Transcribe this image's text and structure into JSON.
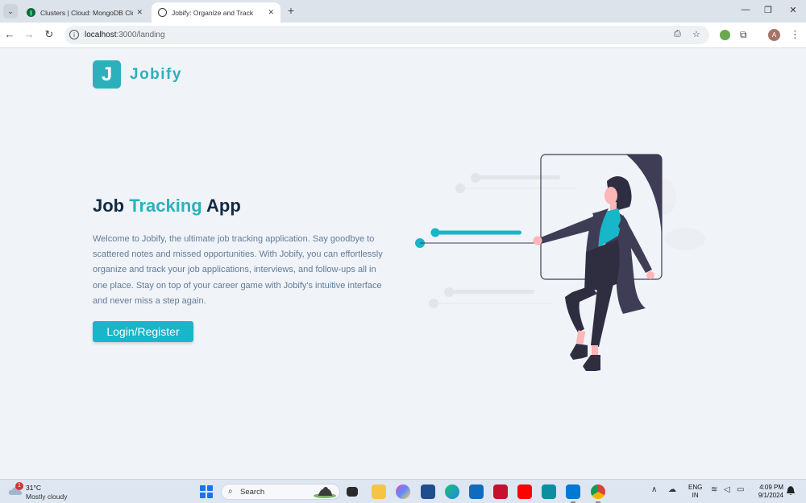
{
  "browser": {
    "tabs": [
      {
        "title": "Clusters | Cloud: MongoDB Cloud",
        "icon": "mongodb-leaf-icon",
        "active": false
      },
      {
        "title": "Jobify: Organize and Track",
        "icon": "globe-icon",
        "active": true
      }
    ],
    "url_host": "localhost",
    "url_path": ":3000/landing",
    "profile_initial": "A"
  },
  "page": {
    "logo_letter": "J",
    "logo_text": "Jobify",
    "title_part1": "Job ",
    "title_accent": "Tracking",
    "title_part2": " App",
    "description": "Welcome to Jobify, the ultimate job tracking application. Say goodbye to scattered notes and missed opportunities. With Jobify, you can effortlessly organize and track your job applications, interviews, and follow-ups all in one place. Stay on top of your career game with Jobify's intuitive interface and never miss a step again.",
    "cta_label": "Login/Register",
    "colors": {
      "primary": "#2cb1bc",
      "button": "#17b6c8",
      "heading": "#102a43",
      "text": "#627d98",
      "background": "#f0f3f8"
    }
  },
  "taskbar": {
    "weather_temp": "31°C",
    "weather_condition": "Mostly cloudy",
    "weather_badge": "1",
    "search_label": "Search",
    "lang_line1": "ENG",
    "lang_line2": "IN",
    "time": "4:09 PM",
    "date": "9/1/2024"
  }
}
